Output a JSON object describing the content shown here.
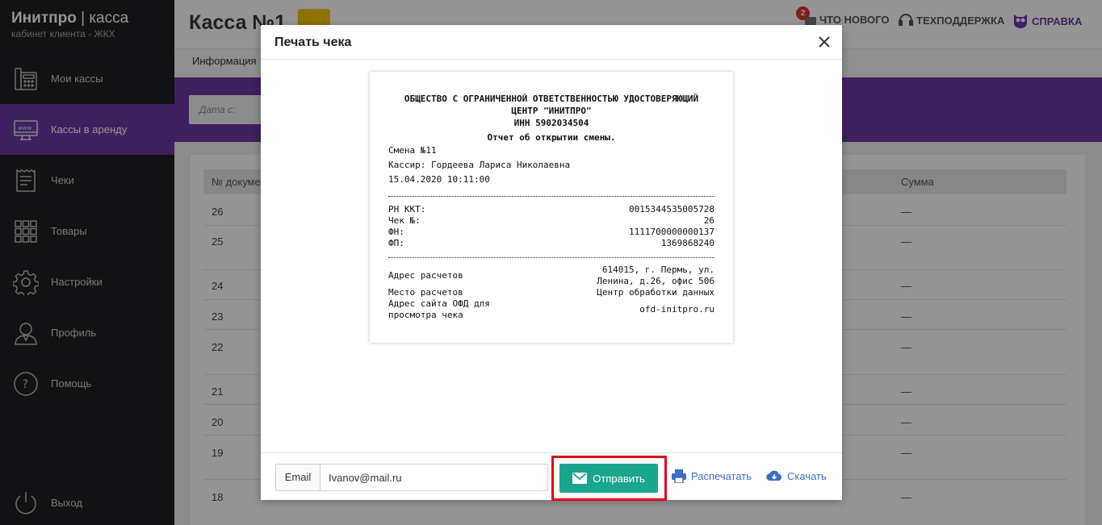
{
  "app": {
    "logo_brand": "Инитпро",
    "logo_product": "касса",
    "logo_subtitle": "кабинет клиента - ЖКХ"
  },
  "sidebar": {
    "items": [
      {
        "label": "Мои кассы",
        "icon": "cash-register-icon"
      },
      {
        "label": "Кассы в аренду",
        "icon": "www-monitor-icon",
        "active": true
      },
      {
        "label": "Чеки",
        "icon": "receipt-icon"
      },
      {
        "label": "Товары",
        "icon": "grid-icon"
      },
      {
        "label": "Настройки",
        "icon": "gear-icon"
      },
      {
        "label": "Профиль",
        "icon": "user-icon"
      },
      {
        "label": "Помощь",
        "icon": "question-icon"
      }
    ],
    "logout_label": "Выход"
  },
  "header": {
    "title": "Касса №1",
    "whats_new_label": "ЧТО НОВОГО",
    "whats_new_count": "2",
    "support_label": "ТЕХПОДДЕРЖКА",
    "help_label": "СПРАВКА"
  },
  "tabs": {
    "info_label": "Информация"
  },
  "filter": {
    "date_placeholder": "Дата с:"
  },
  "table": {
    "col_doc": "№ докуме",
    "col_sum": "Сумма",
    "rows": [
      {
        "doc": "26",
        "sum": "—"
      },
      {
        "doc": "25",
        "sum": "—"
      },
      {
        "doc": "24",
        "sum": "—"
      },
      {
        "doc": "23",
        "sum": "—"
      },
      {
        "doc": "22",
        "sum": "—"
      },
      {
        "doc": "21",
        "sum": "—"
      },
      {
        "doc": "20",
        "sum": "—"
      },
      {
        "doc": "19",
        "sum": "—"
      },
      {
        "doc": "18",
        "sum": "—"
      }
    ]
  },
  "modal": {
    "title": "Печать чека",
    "receipt": {
      "org_line1": "ОБЩЕСТВО С ОГРАНИЧЕННОЙ ОТВЕТСТВЕННОСТЬЮ УДОСТОВЕРЯЮЩИЙ",
      "org_line2": "ЦЕНТР \"ИНИТПРО\"",
      "inn": "ИНН 5902034504",
      "report_title": "Отчет об открытии смены.",
      "shift": "Смена №11",
      "cashier": "Кассир: Гордеева Лариса Николаевна",
      "datetime": "15.04.2020 10:11:00",
      "rn_kkt_label": "РН ККТ:",
      "rn_kkt_value": "0015344535005728",
      "check_no_label": "Чек №:",
      "check_no_value": "26",
      "fn_label": "ФН:",
      "fn_value": "1111700000000137",
      "fp_label": "ФП:",
      "fp_value": "1369868240",
      "address_label": "Адрес расчетов",
      "address_value_1": "614015, г. Пермь, ул.",
      "address_value_2": "Ленина, д.26, офис 506",
      "place_label": "Место расчетов",
      "place_value": "Центр обработки данных",
      "ofd_label_1": "Адрес сайта ОФД для",
      "ofd_label_2": "просмотра чека",
      "ofd_value": "ofd-initpro.ru"
    },
    "email_label": "Email",
    "email_value": "Ivanov@mail.ru",
    "send_label": "Отправить",
    "print_label": "Распечатать",
    "download_label": "Скачать"
  },
  "colors": {
    "accent_purple": "#6b3aa3",
    "send_green": "#19a68f",
    "highlight_red": "#e4001b",
    "edit_yellow": "#f5c400",
    "link_blue": "#3d6fc4"
  }
}
